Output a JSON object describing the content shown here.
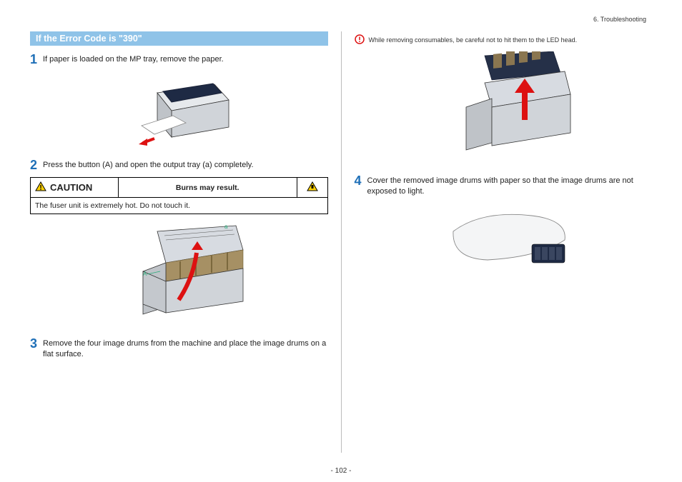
{
  "header": {
    "section": "6. Troubleshooting"
  },
  "title": "If the Error Code is \"390\"",
  "steps": {
    "s1": {
      "num": "1",
      "text": "If paper is loaded on the MP tray, remove the paper."
    },
    "s2": {
      "num": "2",
      "text": "Press the button (A) and open the output tray (a) completely."
    },
    "s3": {
      "num": "3",
      "text": "Remove the four image drums from the machine and place the image drums on a flat surface."
    },
    "s4": {
      "num": "4",
      "text": "Cover the removed image drums with paper so that the image drums are not exposed to light."
    }
  },
  "caution": {
    "label": "CAUTION",
    "subhead": "Burns may result.",
    "body": "The fuser unit is extremely hot. Do not touch it."
  },
  "note": "While removing consumables, be careful not to hit them to the LED head.",
  "page": "- 102 -"
}
